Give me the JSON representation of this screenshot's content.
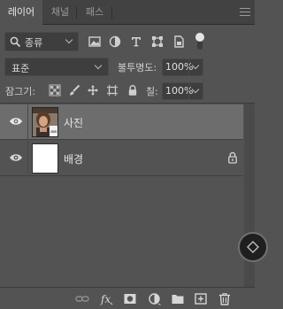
{
  "tabs": [
    {
      "label": "레이어",
      "active": true
    },
    {
      "label": "채널",
      "active": false
    },
    {
      "label": "패스",
      "active": false
    }
  ],
  "filter": {
    "kind_label": "종류",
    "icons": [
      "image-filter-icon",
      "adjustment-filter-icon",
      "type-filter-icon",
      "shape-filter-icon",
      "smart-object-filter-icon",
      "filter-toggle-switch"
    ]
  },
  "blend": {
    "mode": "표준",
    "opacity_label": "불투명도:",
    "opacity_value": "100%"
  },
  "lock": {
    "label": "잠그기:",
    "fill_label": "칠:",
    "fill_value": "100%"
  },
  "layers": [
    {
      "name": "사진",
      "visible": true,
      "selected": true,
      "locked": false
    },
    {
      "name": "배경",
      "visible": true,
      "selected": false,
      "locked": true
    }
  ],
  "colors": {
    "panel_bg": "#535353",
    "selected_row": "#6d6d6d",
    "tab_bar": "#424242"
  }
}
